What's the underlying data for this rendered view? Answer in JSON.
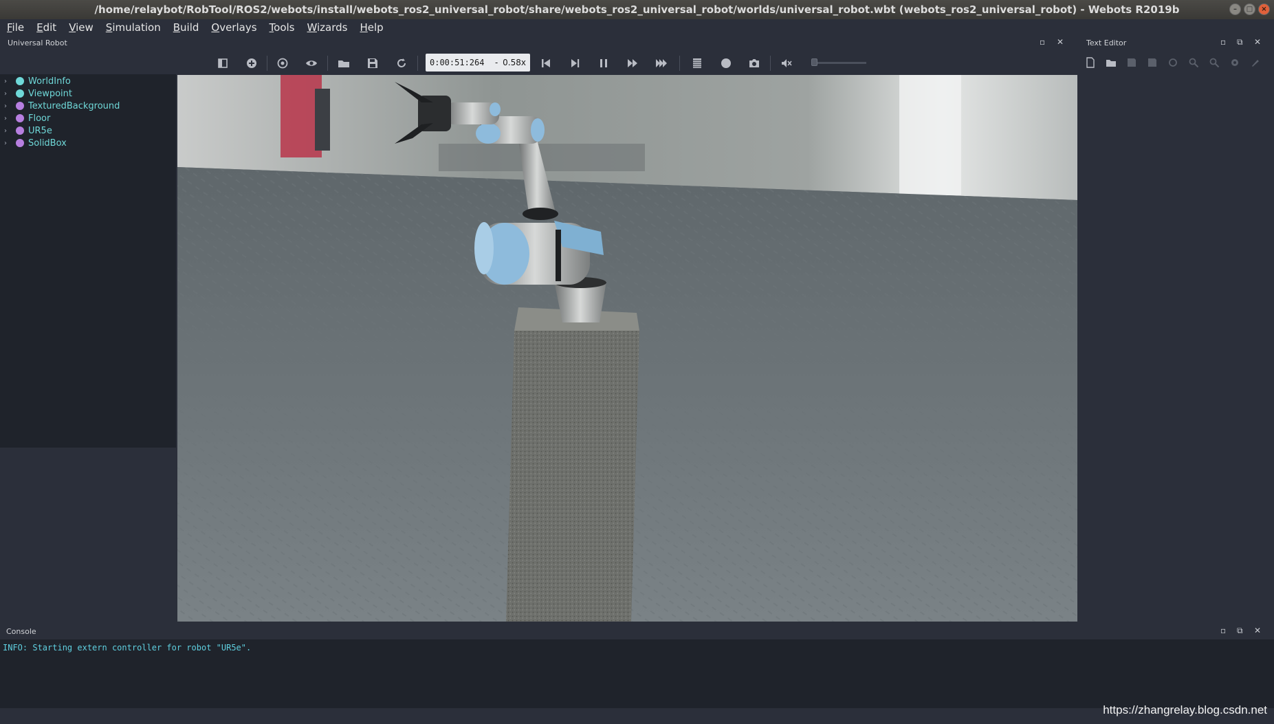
{
  "window": {
    "title": "/home/relaybot/RobTool/ROS2/webots/install/webots_ros2_universal_robot/share/webots_ros2_universal_robot/worlds/universal_robot.wbt (webots_ros2_universal_robot) - Webots R2019b",
    "controls": {
      "minimize": "–",
      "maximize": "□",
      "close": "×"
    }
  },
  "menu": [
    {
      "label": "File",
      "accel": "F",
      "rest": "ile"
    },
    {
      "label": "Edit",
      "accel": "E",
      "rest": "dit"
    },
    {
      "label": "View",
      "accel": "V",
      "rest": "iew"
    },
    {
      "label": "Simulation",
      "accel": "S",
      "rest": "imulation"
    },
    {
      "label": "Build",
      "accel": "B",
      "rest": "uild"
    },
    {
      "label": "Overlays",
      "accel": "O",
      "rest": "verlays"
    },
    {
      "label": "Tools",
      "accel": "T",
      "rest": "ools"
    },
    {
      "label": "Wizards",
      "accel": "W",
      "rest": "izards"
    },
    {
      "label": "Help",
      "accel": "H",
      "rest": "elp"
    }
  ],
  "scene_panel": {
    "title": "Universal Robot"
  },
  "toolbar": {
    "time": "0:00:51:264",
    "dash": "-",
    "speed": "0.58x"
  },
  "scene_tree": [
    {
      "label": "WorldInfo",
      "color": "#6fd8d8"
    },
    {
      "label": "Viewpoint",
      "color": "#6fd8d8"
    },
    {
      "label": "TexturedBackground",
      "color": "#b77fe0"
    },
    {
      "label": "Floor",
      "color": "#b77fe0"
    },
    {
      "label": "UR5e",
      "color": "#b77fe0"
    },
    {
      "label": "SolidBox",
      "color": "#b77fe0"
    }
  ],
  "text_editor": {
    "title": "Text Editor"
  },
  "console": {
    "title": "Console",
    "line": "INFO: Starting extern controller for robot \"UR5e\"."
  },
  "watermark": "https://zhangrelay.blog.csdn.net"
}
